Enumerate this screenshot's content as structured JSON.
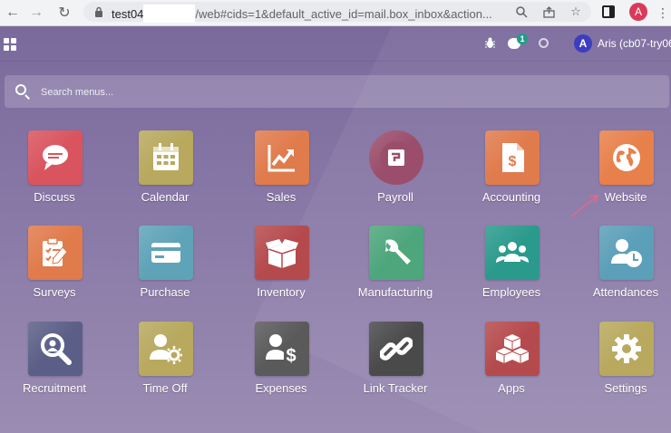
{
  "browser": {
    "url_host": "test04",
    "url_path": "/web#cids=1&default_active_id=mail.box_inbox&action...",
    "profile_initial": "A"
  },
  "topbar": {
    "chat_badge": "1",
    "user_initial": "A",
    "user_name": "Aris (cb07-try06)"
  },
  "search": {
    "placeholder": "Search menus..."
  },
  "apps": [
    {
      "label": "Discuss",
      "color": "#d9545f",
      "icon": "discuss-icon"
    },
    {
      "label": "Calendar",
      "color": "#b8a95e",
      "icon": "calendar-icon"
    },
    {
      "label": "Sales",
      "color": "#e07b4c",
      "icon": "sales-icon"
    },
    {
      "label": "Payroll",
      "color": "#9b4e6b",
      "icon": "payroll-icon"
    },
    {
      "label": "Accounting",
      "color": "#e07b4c",
      "icon": "accounting-icon"
    },
    {
      "label": "Website",
      "color": "#e8804a",
      "icon": "website-icon"
    },
    {
      "label": "Surveys",
      "color": "#e07b4c",
      "icon": "surveys-icon"
    },
    {
      "label": "Purchase",
      "color": "#5fa3b8",
      "icon": "purchase-icon"
    },
    {
      "label": "Inventory",
      "color": "#b54a4d",
      "icon": "inventory-icon"
    },
    {
      "label": "Manufacturing",
      "color": "#4ea67c",
      "icon": "manufacturing-icon"
    },
    {
      "label": "Employees",
      "color": "#2a9a8c",
      "icon": "employees-icon"
    },
    {
      "label": "Attendances",
      "color": "#5b9fb8",
      "icon": "attendances-icon"
    },
    {
      "label": "Recruitment",
      "color": "#5b5f87",
      "icon": "recruitment-icon"
    },
    {
      "label": "Time Off",
      "color": "#b8a95e",
      "icon": "time-off-icon"
    },
    {
      "label": "Expenses",
      "color": "#5a5a5a",
      "icon": "expenses-icon"
    },
    {
      "label": "Link Tracker",
      "color": "#4a4a4a",
      "icon": "link-tracker-icon"
    },
    {
      "label": "Apps",
      "color": "#b54a4d",
      "icon": "apps-icon"
    },
    {
      "label": "Settings",
      "color": "#b8a95e",
      "icon": "settings-icon"
    }
  ]
}
